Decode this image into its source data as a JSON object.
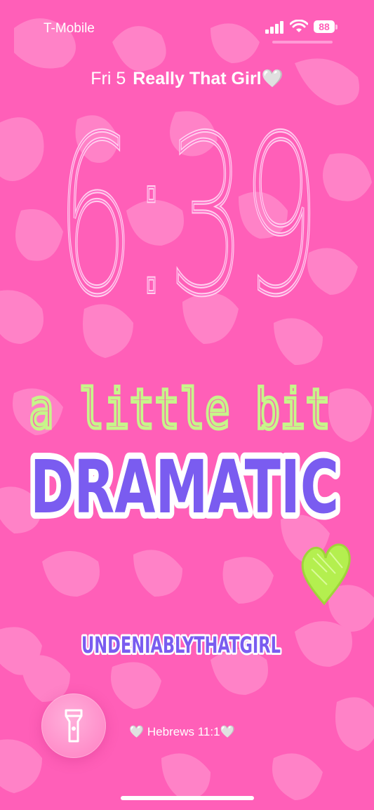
{
  "status_bar": {
    "carrier": "T-Mobile",
    "signal_icon": "signal-bars-icon",
    "wifi_icon": "wifi-icon",
    "battery_level": "88"
  },
  "lockscreen": {
    "date": "Fri 5",
    "widget_text": "Really That Girl🤍",
    "time": "6:39"
  },
  "wallpaper": {
    "line1": "a little bit",
    "line2": "DRAMATIC",
    "username": "UNDENIABLYTHATGIRL",
    "background_color": "#ff5fb8",
    "spot_color": "#ff86c9",
    "line1_color": "#c7f58a",
    "line2_color": "#7a5cf0",
    "heart_color": "#b4ef4f"
  },
  "bottom": {
    "flashlight_icon": "flashlight-icon",
    "verse": "🤍 Hebrews 11:1🤍"
  }
}
